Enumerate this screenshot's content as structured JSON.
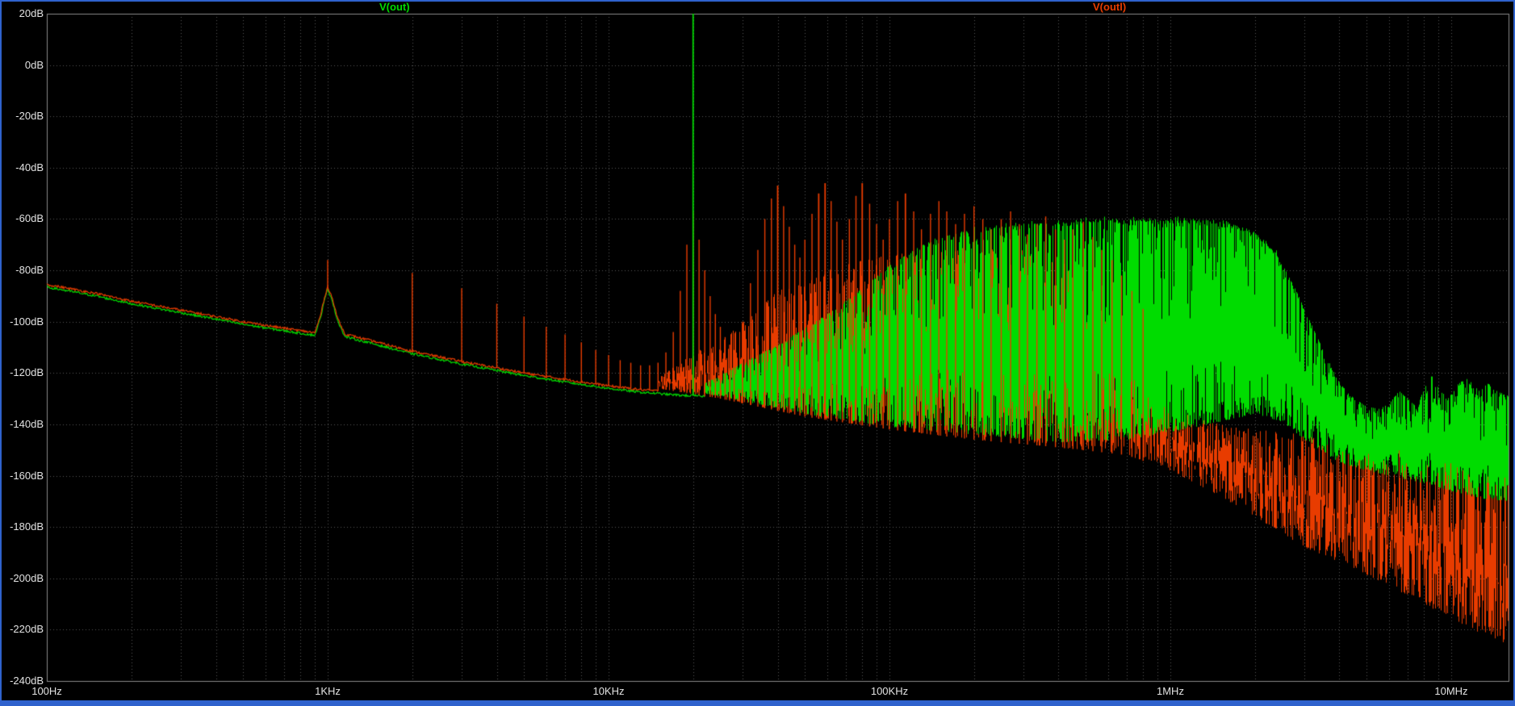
{
  "colors": {
    "background": "#000000",
    "grid": "#575757",
    "axis_text": "#e2e2e2",
    "plot_frame": "#8a8a8a",
    "window_border": "#2f62cd",
    "trace_green": "#00dc00",
    "trace_red": "#e83c00"
  },
  "legend": {
    "items": [
      {
        "label": "V(out)",
        "color": "#00dc00"
      },
      {
        "label": "V(outl)",
        "color": "#e83c00"
      }
    ]
  },
  "axes": {
    "y": {
      "max_db": 20,
      "min_db": -240,
      "step_db": 20,
      "labels": [
        "20dB",
        "0dB",
        "-20dB",
        "-40dB",
        "-60dB",
        "-80dB",
        "-100dB",
        "-120dB",
        "-140dB",
        "-160dB",
        "-180dB",
        "-200dB",
        "-220dB",
        "-240dB"
      ]
    },
    "x": {
      "scale": "log",
      "min_hz": 100,
      "max_hz": 16000000,
      "ticks": [
        {
          "hz": 100,
          "label": "100Hz"
        },
        {
          "hz": 1000,
          "label": "1KHz"
        },
        {
          "hz": 10000,
          "label": "10KHz"
        },
        {
          "hz": 100000,
          "label": "100KHz"
        },
        {
          "hz": 1000000,
          "label": "1MHz"
        },
        {
          "hz": 10000000,
          "label": "10MHz"
        }
      ]
    }
  },
  "chart_data": {
    "type": "line",
    "subtype": "fft-spectrum",
    "x_scale": "log",
    "x_range_hz": [
      100,
      16000000
    ],
    "y_range_db": [
      -240,
      20
    ],
    "grid": "dotted",
    "series": [
      {
        "name": "V(out)",
        "color": "#00dc00",
        "line_env": [
          [
            100,
            -86.5
          ],
          [
            150,
            -90
          ],
          [
            200,
            -93
          ],
          [
            300,
            -96.5
          ],
          [
            400,
            -99
          ],
          [
            500,
            -101
          ],
          [
            650,
            -103
          ],
          [
            800,
            -104.5
          ],
          [
            900,
            -105.3
          ],
          [
            940,
            -99
          ],
          [
            980,
            -90.5
          ],
          [
            1000,
            -87.5
          ],
          [
            1030,
            -90.5
          ],
          [
            1080,
            -99
          ],
          [
            1150,
            -105.8
          ],
          [
            1500,
            -109
          ],
          [
            2000,
            -112.5
          ],
          [
            3000,
            -116.5
          ],
          [
            4000,
            -119
          ],
          [
            5000,
            -121
          ],
          [
            7000,
            -123.5
          ],
          [
            10000,
            -126
          ],
          [
            13000,
            -127.5
          ],
          [
            15000,
            -128
          ],
          [
            18000,
            -128.7
          ],
          [
            22000,
            -129
          ]
        ],
        "fill_start_hz": 22000,
        "upper_env": [
          [
            22000,
            -124
          ],
          [
            30000,
            -116
          ],
          [
            40000,
            -109
          ],
          [
            60000,
            -97
          ],
          [
            80000,
            -87
          ],
          [
            100000,
            -78
          ],
          [
            140000,
            -68
          ],
          [
            200000,
            -64
          ],
          [
            300000,
            -62
          ],
          [
            600000,
            -60.5
          ],
          [
            1200000,
            -60.5
          ],
          [
            1600000,
            -62
          ],
          [
            2000000,
            -66
          ],
          [
            2400000,
            -74
          ],
          [
            2800000,
            -88
          ],
          [
            3200000,
            -102
          ],
          [
            3600000,
            -114
          ],
          [
            4000000,
            -124
          ],
          [
            4500000,
            -130
          ],
          [
            5000000,
            -133
          ],
          [
            5500000,
            -134
          ],
          [
            6000000,
            -132
          ],
          [
            6500000,
            -127
          ],
          [
            7000000,
            -130
          ],
          [
            7500000,
            -133
          ],
          [
            8000000,
            -126
          ],
          [
            8500000,
            -121
          ],
          [
            9000000,
            -126
          ],
          [
            9700000,
            -130
          ],
          [
            10500000,
            -124
          ],
          [
            11500000,
            -122
          ],
          [
            12500000,
            -127
          ],
          [
            13500000,
            -124
          ],
          [
            14500000,
            -127
          ],
          [
            16000000,
            -129
          ]
        ],
        "lower_env": [
          [
            22000,
            -128
          ],
          [
            30000,
            -131
          ],
          [
            50000,
            -136
          ],
          [
            100000,
            -141
          ],
          [
            200000,
            -144
          ],
          [
            400000,
            -147
          ],
          [
            700000,
            -146
          ],
          [
            1000000,
            -143
          ],
          [
            1500000,
            -139
          ],
          [
            2000000,
            -136
          ],
          [
            2500000,
            -139
          ],
          [
            3000000,
            -146
          ],
          [
            4000000,
            -155
          ],
          [
            5000000,
            -158
          ],
          [
            6000000,
            -160
          ],
          [
            8000000,
            -163
          ],
          [
            10000000,
            -166
          ],
          [
            13000000,
            -169
          ],
          [
            16000000,
            -170
          ]
        ],
        "spikes": [
          [
            20000,
            20
          ]
        ],
        "comb": {
          "start_hz": 40000,
          "step_hz": 20000,
          "end_hz": 2400000
        }
      },
      {
        "name": "V(outl)",
        "color": "#e83c00",
        "line_env": [
          [
            100,
            -85.5
          ],
          [
            150,
            -89
          ],
          [
            200,
            -92
          ],
          [
            300,
            -95.5
          ],
          [
            400,
            -98
          ],
          [
            500,
            -100
          ],
          [
            650,
            -102
          ],
          [
            800,
            -103.5
          ],
          [
            900,
            -104.3
          ],
          [
            940,
            -98
          ],
          [
            980,
            -89.5
          ],
          [
            1000,
            -86.5
          ],
          [
            1030,
            -89.5
          ],
          [
            1080,
            -98
          ],
          [
            1150,
            -104.8
          ],
          [
            1500,
            -108
          ],
          [
            2000,
            -111.5
          ],
          [
            3000,
            -115.5
          ],
          [
            4000,
            -118
          ],
          [
            5000,
            -120
          ],
          [
            7000,
            -122.5
          ],
          [
            10000,
            -125
          ],
          [
            13000,
            -126.5
          ],
          [
            15000,
            -127
          ]
        ],
        "fill_start_hz": 15000,
        "upper_env": [
          [
            15000,
            -122
          ],
          [
            20000,
            -112
          ],
          [
            25000,
            -108
          ],
          [
            30000,
            -100
          ],
          [
            40000,
            -88
          ],
          [
            60000,
            -80
          ],
          [
            80000,
            -76
          ],
          [
            100000,
            -74
          ],
          [
            150000,
            -72
          ],
          [
            200000,
            -70
          ],
          [
            300000,
            -72
          ],
          [
            400000,
            -76
          ],
          [
            500000,
            -82
          ],
          [
            600000,
            -92
          ],
          [
            700000,
            -105
          ],
          [
            800000,
            -118
          ],
          [
            900000,
            -128
          ],
          [
            1000000,
            -134
          ],
          [
            1500000,
            -140
          ],
          [
            2000000,
            -142
          ],
          [
            3000000,
            -144
          ],
          [
            5000000,
            -147
          ],
          [
            8000000,
            -149
          ],
          [
            12000000,
            -151
          ],
          [
            16000000,
            -152
          ]
        ],
        "lower_env": [
          [
            15000,
            -126
          ],
          [
            25000,
            -130
          ],
          [
            50000,
            -137
          ],
          [
            100000,
            -142
          ],
          [
            200000,
            -146
          ],
          [
            400000,
            -149
          ],
          [
            700000,
            -152
          ],
          [
            1000000,
            -158
          ],
          [
            1500000,
            -168
          ],
          [
            2000000,
            -176
          ],
          [
            3000000,
            -188
          ],
          [
            4500000,
            -196
          ],
          [
            6000000,
            -203
          ],
          [
            8000000,
            -210
          ],
          [
            10000000,
            -216
          ],
          [
            13000000,
            -222
          ],
          [
            16000000,
            -226
          ]
        ],
        "spikes": [
          [
            1000,
            -76
          ],
          [
            2000,
            -81
          ],
          [
            3000,
            -87
          ],
          [
            4000,
            -93
          ],
          [
            5000,
            -98
          ],
          [
            6000,
            -102
          ],
          [
            7000,
            -105
          ],
          [
            8000,
            -108
          ],
          [
            9000,
            -111
          ],
          [
            10000,
            -113
          ],
          [
            11000,
            -115
          ],
          [
            12000,
            -116
          ],
          [
            13000,
            -117
          ],
          [
            14000,
            -117
          ],
          [
            15000,
            -116
          ],
          [
            16000,
            -112
          ],
          [
            17000,
            -104
          ],
          [
            18000,
            -88
          ],
          [
            19000,
            -70
          ],
          [
            20000,
            -57
          ],
          [
            21000,
            -68
          ],
          [
            22000,
            -80
          ],
          [
            23000,
            -90
          ],
          [
            24000,
            -97
          ],
          [
            25000,
            -102
          ],
          [
            26000,
            -106
          ],
          [
            27000,
            -109
          ],
          [
            28000,
            -111
          ],
          [
            30000,
            -100
          ],
          [
            32000,
            -85
          ],
          [
            34000,
            -72
          ],
          [
            36000,
            -60
          ],
          [
            38000,
            -52
          ],
          [
            40000,
            -47
          ],
          [
            42000,
            -55
          ],
          [
            44000,
            -63
          ],
          [
            46000,
            -70
          ],
          [
            48000,
            -75
          ],
          [
            50000,
            -68
          ],
          [
            53000,
            -58
          ],
          [
            56000,
            -50
          ],
          [
            59000,
            -46
          ],
          [
            62000,
            -53
          ],
          [
            65000,
            -61
          ],
          [
            68000,
            -68
          ],
          [
            72000,
            -60
          ],
          [
            76000,
            -51
          ],
          [
            80000,
            -46
          ],
          [
            85000,
            -54
          ],
          [
            90000,
            -62
          ],
          [
            95000,
            -68
          ],
          [
            100000,
            -60
          ],
          [
            107000,
            -53
          ],
          [
            114000,
            -50
          ],
          [
            122000,
            -57
          ],
          [
            130000,
            -64
          ],
          [
            140000,
            -58
          ],
          [
            150000,
            -53
          ],
          [
            160000,
            -57
          ],
          [
            172000,
            -62
          ],
          [
            185000,
            -58
          ],
          [
            200000,
            -55
          ],
          [
            215000,
            -60
          ],
          [
            230000,
            -64
          ],
          [
            250000,
            -60
          ],
          [
            270000,
            -57
          ],
          [
            290000,
            -62
          ],
          [
            310000,
            -66
          ],
          [
            335000,
            -62
          ],
          [
            360000,
            -59
          ],
          [
            390000,
            -64
          ],
          [
            420000,
            -68
          ],
          [
            450000,
            -64
          ],
          [
            490000,
            -61
          ],
          [
            530000,
            -67
          ],
          [
            570000,
            -72
          ],
          [
            620000,
            -76
          ],
          [
            670000,
            -82
          ],
          [
            730000,
            -88
          ],
          [
            800000,
            -95
          ]
        ]
      }
    ]
  }
}
